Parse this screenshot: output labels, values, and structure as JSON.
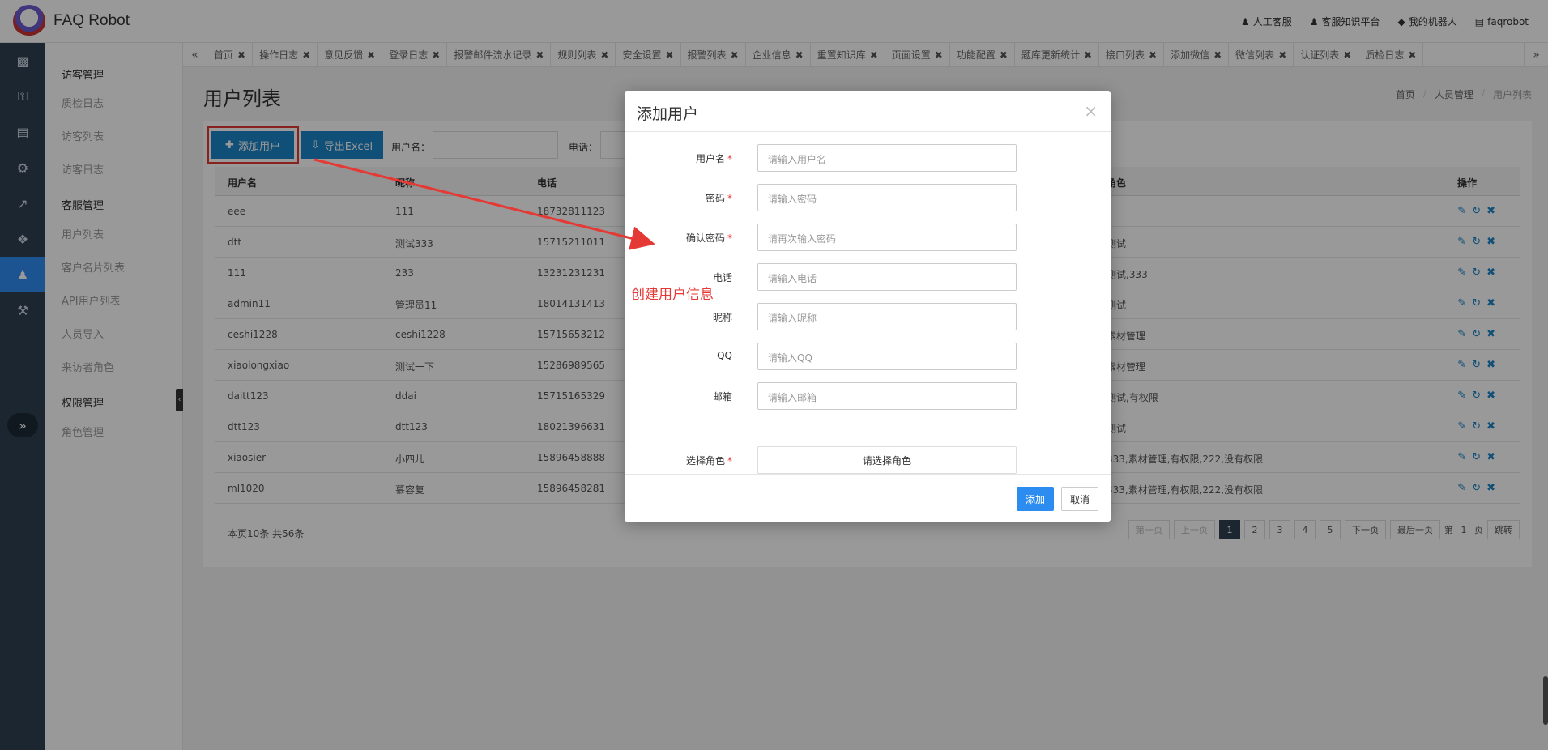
{
  "app": {
    "brand": "FAQ Robot"
  },
  "topnav": [
    {
      "icon": "user-icon",
      "label": "人工客服"
    },
    {
      "icon": "users-icon",
      "label": "客服知识平台"
    },
    {
      "icon": "robot-icon",
      "label": "我的机器人"
    },
    {
      "icon": "account-icon",
      "label": "faqrobot"
    }
  ],
  "sidebar": {
    "groups": [
      {
        "title": "访客管理",
        "items": [
          "质检日志",
          "访客列表",
          "访客日志"
        ]
      },
      {
        "title": "客服管理",
        "items": [
          "用户列表",
          "客户名片列表",
          "API用户列表",
          "人员导入",
          "来访者角色"
        ]
      },
      {
        "title": "权限管理",
        "items": [
          "角色管理"
        ]
      }
    ]
  },
  "tabs": [
    "首页",
    "操作日志",
    "意见反馈",
    "登录日志",
    "报警邮件流水记录",
    "规则列表",
    "安全设置",
    "报警列表",
    "企业信息",
    "重置知识库",
    "页面设置",
    "功能配置",
    "题库更新统计",
    "接口列表",
    "添加微信",
    "微信列表",
    "认证列表",
    "质检日志"
  ],
  "page": {
    "title": "用户列表",
    "breadcrumb": [
      "首页",
      "人员管理",
      "用户列表"
    ],
    "add_button": "添加用户",
    "export_button": "导出Excel",
    "filter_username_label": "用户名：",
    "filter_phone_label": "电话："
  },
  "table": {
    "headers": {
      "username": "用户名",
      "nickname": "昵称",
      "phone": "电话",
      "role": "角色",
      "ops": "操作"
    },
    "rows": [
      {
        "username": "eee",
        "nickname": "111",
        "phone": "18732811123",
        "role": ""
      },
      {
        "username": "dtt",
        "nickname": "测试333",
        "phone": "15715211011",
        "role": "测试"
      },
      {
        "username": "111",
        "nickname": "233",
        "phone": "13231231231",
        "role": "测试,333"
      },
      {
        "username": "admin11",
        "nickname": "管理员11",
        "phone": "18014131413",
        "role": "测试"
      },
      {
        "username": "ceshi1228",
        "nickname": "ceshi1228",
        "phone": "15715653212",
        "role": "素材管理"
      },
      {
        "username": "xiaolongxiao",
        "nickname": "测试一下",
        "phone": "15286989565",
        "role": "素材管理"
      },
      {
        "username": "daitt123",
        "nickname": "ddai",
        "phone": "15715165329",
        "role": "测试,有权限"
      },
      {
        "username": "dtt123",
        "nickname": "dtt123",
        "phone": "18021396631",
        "role": "测试"
      },
      {
        "username": "xiaosier",
        "nickname": "小四儿",
        "phone": "15896458888",
        "role": "333,素材管理,有权限,222,没有权限"
      },
      {
        "username": "ml1020",
        "nickname": "慕容复",
        "phone": "15896458281",
        "role": "333,素材管理,有权限,222,没有权限"
      }
    ],
    "summary": "本页10条 共56条"
  },
  "pager": {
    "first": "第一页",
    "prev": "上一页",
    "pages": [
      "1",
      "2",
      "3",
      "4",
      "5"
    ],
    "current": "1",
    "next": "下一页",
    "last": "最后一页",
    "goto_prefix": "第",
    "goto_value": "1",
    "goto_suffix": "页",
    "goto_button": "跳转"
  },
  "modal": {
    "title": "添加用户",
    "fields": [
      {
        "label": "用户名",
        "required": true,
        "placeholder": "请输入用户名"
      },
      {
        "label": "密码",
        "required": true,
        "placeholder": "请输入密码"
      },
      {
        "label": "确认密码",
        "required": true,
        "placeholder": "请再次输入密码"
      },
      {
        "label": "电话",
        "required": false,
        "placeholder": "请输入电话"
      },
      {
        "label": "昵称",
        "required": false,
        "placeholder": "请输入昵称"
      },
      {
        "label": "QQ",
        "required": false,
        "placeholder": "请输入QQ"
      },
      {
        "label": "邮箱",
        "required": false,
        "placeholder": "请输入邮箱"
      }
    ],
    "role_label": "选择角色",
    "role_button": "请选择角色",
    "ok": "添加",
    "cancel": "取消"
  },
  "annotation": {
    "text": "创建用户信息",
    "color": "#e53935"
  },
  "colors": {
    "primary": "#1c84c6",
    "sidebar": "#2f4050",
    "active": "#2d8cf0",
    "danger": "#e53935"
  }
}
